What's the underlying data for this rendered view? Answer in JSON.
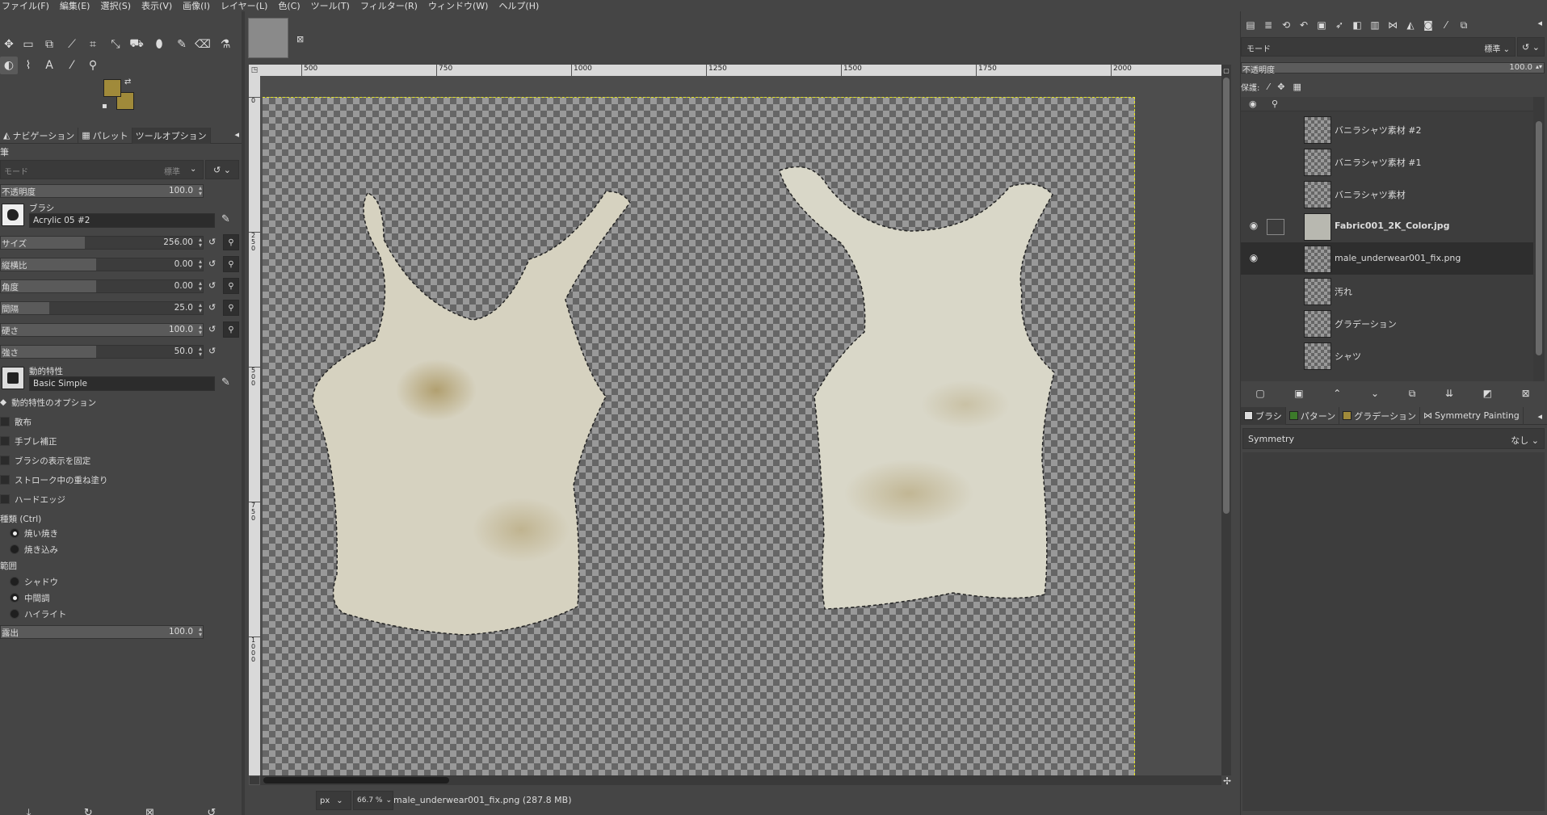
{
  "menu": [
    "ファイル(F)",
    "編集(E)",
    "選択(S)",
    "表示(V)",
    "画像(I)",
    "レイヤー(L)",
    "色(C)",
    "ツール(T)",
    "フィルター(R)",
    "ウィンドウ(W)",
    "ヘルプ(H)"
  ],
  "colors": {
    "foreground": "#a08a3a",
    "background": "#a08a3a",
    "selection_marching_ants": "#e6e61e"
  },
  "left_tabs": [
    {
      "label": "ナビゲーション",
      "icon": "navigation-icon"
    },
    {
      "label": "パレット",
      "icon": "palette-icon"
    },
    {
      "label": "ツールオプション",
      "icon": ""
    }
  ],
  "tool_options": {
    "title": "筆",
    "mode_placeholder": "モード",
    "mode_value": "標準",
    "opacity": {
      "label": "不透明度",
      "value": "100.0"
    },
    "brush": {
      "label": "ブラシ",
      "name": "Acrylic 05 #2"
    },
    "size": {
      "label": "サイズ",
      "value": "256.00"
    },
    "aspect": {
      "label": "縦横比",
      "value": "0.00"
    },
    "angle": {
      "label": "角度",
      "value": "0.00"
    },
    "spacing": {
      "label": "間隔",
      "value": "25.0"
    },
    "hardness": {
      "label": "硬さ",
      "value": "100.0"
    },
    "force": {
      "label": "強さ",
      "value": "50.0"
    },
    "dynamics": {
      "label": "動的特性",
      "name": "Basic Simple"
    },
    "dynamics_options": "動的特性のオプション",
    "checks": [
      "散布",
      "手ブレ補正",
      "ブラシの表示を固定",
      "ストローク中の重ね塗り",
      "ハードエッジ"
    ],
    "type": {
      "label": "種類 (Ctrl)",
      "options": [
        "焼い焼き",
        "焼き込み"
      ],
      "selected": 0
    },
    "range": {
      "label": "範囲",
      "options": [
        "シャドウ",
        "中間調",
        "ハイライト"
      ],
      "selected": 1
    },
    "exposure": {
      "label": "露出",
      "value": "100.0"
    }
  },
  "ruler_h": [
    "500",
    "750",
    "1000",
    "1250",
    "1500",
    "1750",
    "2000"
  ],
  "ruler_v": [
    "0",
    "2 5 0",
    "5 0 0",
    "7 5 0",
    "1 0 0 0"
  ],
  "statusbar": {
    "unit": "px",
    "zoom": "66.7 %",
    "text": "male_underwear001_fix.png (287.8 MB)"
  },
  "layers_panel": {
    "mode": "モード",
    "mode_value": "標準",
    "opacity_label": "不透明度",
    "opacity_value": "100.0",
    "lock_label": "保護:",
    "layers": [
      {
        "name": "バニラシャツ素材 #2",
        "visible": false,
        "selected": false,
        "bold": false,
        "thumb": "checker"
      },
      {
        "name": "バニラシャツ素材 #1",
        "visible": false,
        "selected": false,
        "bold": false,
        "thumb": "checker"
      },
      {
        "name": "バニラシャツ素材",
        "visible": false,
        "selected": false,
        "bold": false,
        "thumb": "checker"
      },
      {
        "name": "Fabric001_2K_Color.jpg",
        "visible": true,
        "selected": false,
        "bold": true,
        "thumb": "fabric"
      },
      {
        "name": "male_underwear001_fix.png",
        "visible": true,
        "selected": true,
        "bold": false,
        "thumb": "checker"
      },
      {
        "name": "汚れ",
        "visible": false,
        "selected": false,
        "bold": false,
        "thumb": "checker"
      },
      {
        "name": "グラデーション",
        "visible": false,
        "selected": false,
        "bold": false,
        "thumb": "checker"
      },
      {
        "name": "シャツ",
        "visible": false,
        "selected": false,
        "bold": false,
        "thumb": "checker"
      }
    ]
  },
  "brush_tabs": [
    {
      "label": "ブラシ",
      "swatch": "#dddddd"
    },
    {
      "label": "パターン",
      "swatch": "#3c7a2a"
    },
    {
      "label": "グラデーション",
      "swatch": "#a08a3a"
    },
    {
      "label": "Symmetry Painting",
      "swatch": ""
    }
  ],
  "symmetry": {
    "label": "Symmetry",
    "value": "なし"
  }
}
